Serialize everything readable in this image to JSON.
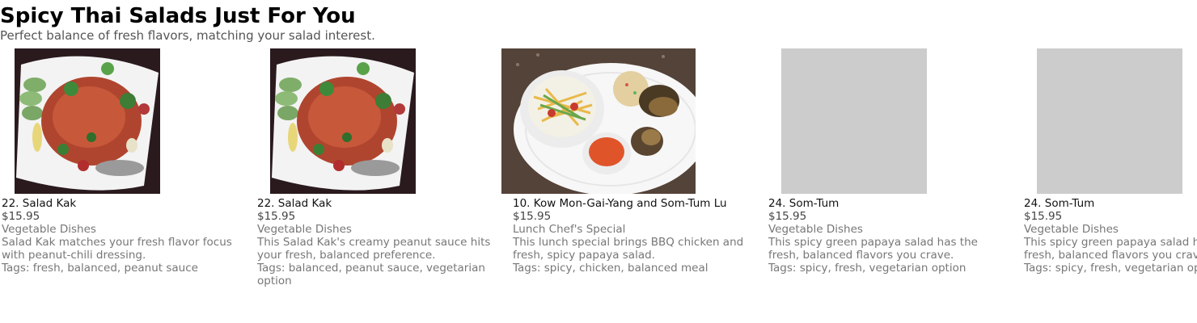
{
  "header": {
    "title": "Spicy Thai Salads Just For You",
    "subtitle": "Perfect balance of fresh flavors, matching your salad interest."
  },
  "cards": [
    {
      "image": "salad-kak-photo",
      "name": "22. Salad Kak",
      "price": "$15.95",
      "category": "Vegetable Dishes",
      "description": "Salad Kak matches your fresh flavor focus with peanut-chili dressing.",
      "tags": "Tags: fresh, balanced, peanut sauce"
    },
    {
      "image": "salad-kak-photo",
      "name": "22. Salad Kak",
      "price": "$15.95",
      "category": "Vegetable Dishes",
      "description": "This Salad Kak's creamy peanut sauce hits your fresh, balanced preference.",
      "tags": "Tags: balanced, peanut sauce, vegetarian option"
    },
    {
      "image": "kow-mon-gai-yang-photo",
      "name": "10. Kow Mon-Gai-Yang and Som-Tum Lu",
      "price": "$15.95",
      "category": "Lunch Chef's Special",
      "description": "This lunch special brings BBQ chicken and fresh, spicy papaya salad.",
      "tags": "Tags: spicy, chicken, balanced meal"
    },
    {
      "image": "placeholder",
      "name": "24. Som-Tum",
      "price": "$15.95",
      "category": "Vegetable Dishes",
      "description": "This spicy green papaya salad has the fresh, balanced flavors you crave.",
      "tags": "Tags: spicy, fresh, vegetarian option"
    },
    {
      "image": "placeholder",
      "name": "24. Som-Tum",
      "price": "$15.95",
      "category": "Vegetable Dishes",
      "description": "This spicy green papaya salad has the fresh, balanced flavors you crave.",
      "tags": "Tags: spicy, fresh, vegetarian option"
    }
  ],
  "colors": {
    "placeholder": "#cccccc",
    "title": "#000000",
    "muted": "#777777"
  }
}
